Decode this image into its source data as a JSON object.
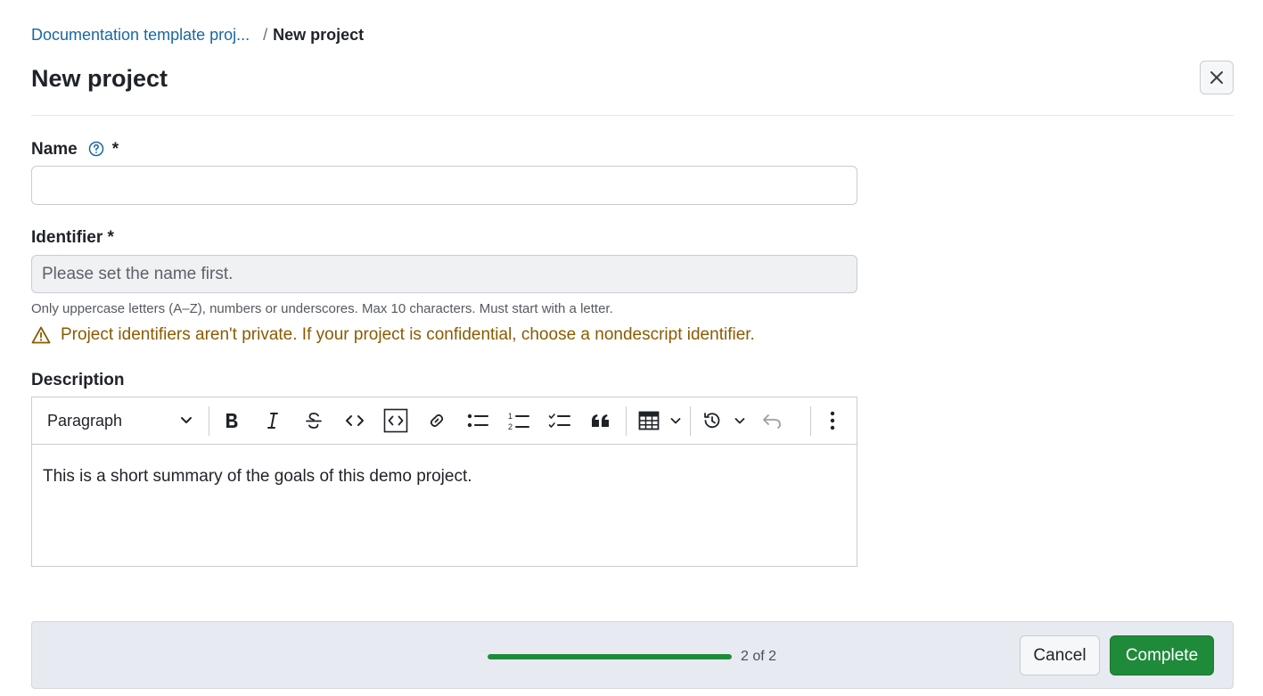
{
  "breadcrumb": {
    "parent": "Documentation template proj...",
    "separator": "/",
    "current": "New project"
  },
  "page": {
    "title": "New project"
  },
  "form": {
    "name": {
      "label": "Name",
      "required_mark": "*",
      "value": "",
      "placeholder": ""
    },
    "identifier": {
      "label": "Identifier *",
      "placeholder": "Please set the name first.",
      "hint": "Only uppercase letters (A–Z), numbers or underscores. Max 10 characters. Must start with a letter.",
      "warning": "Project identifiers aren't private. If your project is confidential, choose a nondescript identifier."
    },
    "description": {
      "label": "Description",
      "block_style": "Paragraph",
      "toolbar": [
        "bold-icon",
        "italic-icon",
        "strikethrough-icon",
        "inline-code-icon",
        "code-block-icon",
        "link-icon",
        "bulleted-list-icon",
        "numbered-list-icon",
        "task-list-icon",
        "blockquote-icon",
        "table-icon",
        "history-icon",
        "undo-icon",
        "more-vertical-icon"
      ],
      "content": "This is a short summary of the goals of this demo project."
    }
  },
  "footer": {
    "progress_fraction": 1.0,
    "step_text": "2 of 2",
    "cancel_label": "Cancel",
    "complete_label": "Complete"
  },
  "colors": {
    "link": "#1a67a3",
    "primary": "#1f8a3a",
    "warning": "#8a5b00",
    "footer_bg": "#e7eaf0"
  }
}
